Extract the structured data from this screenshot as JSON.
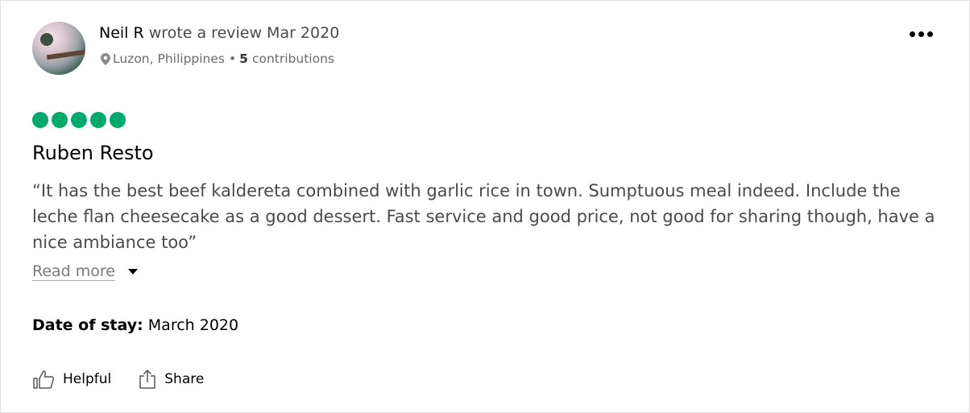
{
  "review": {
    "author": "Neil R",
    "header_text": "wrote a review Mar 2020",
    "location": "Luzon, Philippines",
    "separator": "•",
    "contributions_count": "5",
    "contributions_label": "contributions",
    "rating": {
      "value": 5,
      "max": 5,
      "color": "#00aa6c"
    },
    "title": "Ruben Resto",
    "text": "“It has the best beef kaldereta combined with garlic rice in town. Sumptuous meal indeed. Include the leche flan cheesecake as a good dessert. Fast service and good price, not good for sharing though, have a nice ambiance too”",
    "read_more": "Read more",
    "date_label": "Date of stay:",
    "date_value": "March 2020"
  },
  "actions": {
    "helpful_label": "Helpful",
    "share_label": "Share"
  },
  "icons": {
    "more": "more-horizontal-icon",
    "location": "map-pin-icon",
    "helpful": "thumbs-up-icon",
    "share": "share-icon",
    "read_more": "caret-down-icon"
  }
}
